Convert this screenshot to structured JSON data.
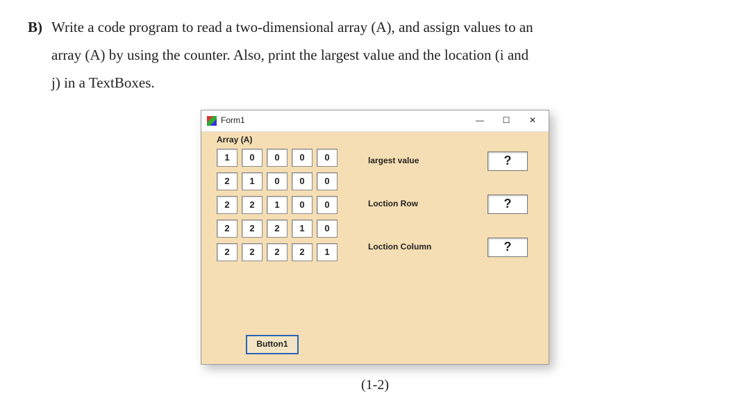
{
  "question": {
    "label": "B)",
    "line1": "Write a code program to read a two-dimensional array (A), and assign values to an",
    "line2": "array (A) by using the counter. Also, print the largest value and the location (i and",
    "line3": "j) in a TextBoxes."
  },
  "form": {
    "title": "Form1",
    "win_min": "—",
    "win_max": "☐",
    "win_close": "✕",
    "group_label": "Array (A)",
    "grid": [
      [
        "1",
        "0",
        "0",
        "0",
        "0"
      ],
      [
        "2",
        "1",
        "0",
        "0",
        "0"
      ],
      [
        "2",
        "2",
        "1",
        "0",
        "0"
      ],
      [
        "2",
        "2",
        "2",
        "1",
        "0"
      ],
      [
        "2",
        "2",
        "2",
        "2",
        "1"
      ]
    ],
    "results": {
      "largest_label": "largest value",
      "largest_value": "?",
      "row_label": "Loction Row",
      "row_value": "?",
      "col_label": "Loction Column",
      "col_value": "?"
    },
    "button_label": "Button1"
  },
  "caption": "(1-2)",
  "chart_data": {
    "type": "table",
    "title": "Array (A)",
    "rows": 5,
    "cols": 5,
    "values": [
      [
        1,
        0,
        0,
        0,
        0
      ],
      [
        2,
        1,
        0,
        0,
        0
      ],
      [
        2,
        2,
        1,
        0,
        0
      ],
      [
        2,
        2,
        2,
        1,
        0
      ],
      [
        2,
        2,
        2,
        2,
        1
      ]
    ]
  }
}
